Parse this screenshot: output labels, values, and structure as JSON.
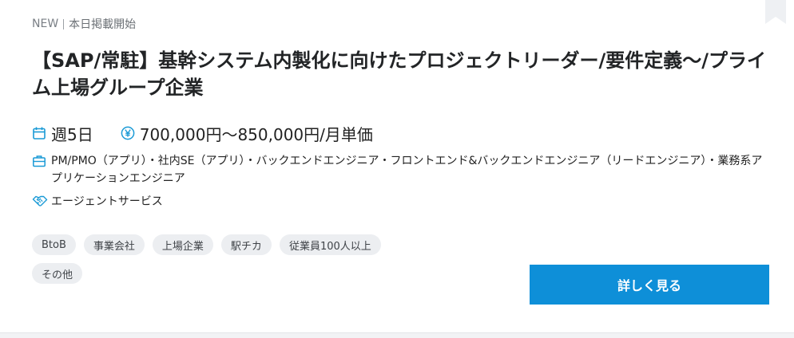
{
  "card": {
    "badge_new": "NEW",
    "status": "本日掲載開始",
    "title": "【SAP/常駐】基幹システム内製化に向けたプロジェクトリーダー/要件定義〜/プライム上場グループ企業",
    "work_days": "週5日",
    "price": "700,000円〜850,000円/月単価",
    "roles": "PM/PMO（アプリ）・社内SE（アプリ）・バックエンドエンジニア・フロントエンド&バックエンドエンジニア（リードエンジニア）・業務系アプリケーションエンジニア",
    "service_type": "エージェントサービス",
    "tags": [
      "BtoB",
      "事業会社",
      "上場企業",
      "駅チカ",
      "従業員100人以上",
      "その他"
    ],
    "detail_button": "詳しく見る"
  },
  "icons": {
    "bookmark": "bookmark-icon",
    "calendar": "calendar-icon",
    "yen": "yen-icon",
    "briefcase": "briefcase-icon",
    "handshake": "handshake-icon"
  },
  "colors": {
    "accent": "#0e8fd8",
    "icon_blue": "#1a9ad6",
    "tag_bg": "#eceef1"
  }
}
